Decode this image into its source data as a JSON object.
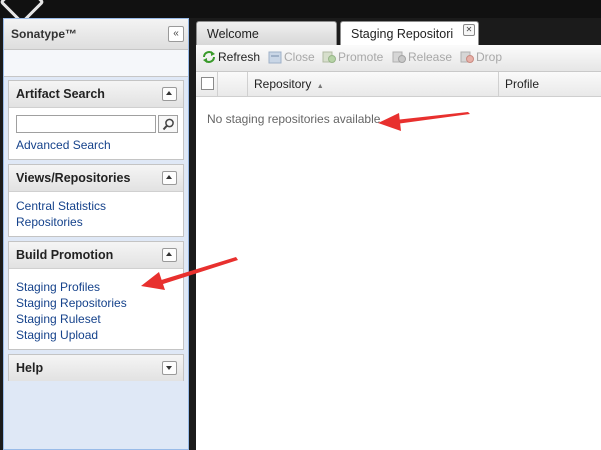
{
  "sidebar": {
    "brand": "Sonatype™",
    "collapse_icon": "«",
    "panels": {
      "artifact_search": {
        "title": "Artifact Search",
        "search_value": "",
        "advanced_link": "Advanced Search"
      },
      "views": {
        "title": "Views/Repositories",
        "links": [
          "Central Statistics",
          "Repositories"
        ]
      },
      "build_promotion": {
        "title": "Build Promotion",
        "links": [
          "Staging Profiles",
          "Staging Repositories",
          "Staging Ruleset",
          "Staging Upload"
        ]
      },
      "help": {
        "title": "Help"
      }
    }
  },
  "tabs": [
    {
      "label": "Welcome"
    },
    {
      "label": "Staging Repositori",
      "close": "✕"
    }
  ],
  "toolbar": {
    "refresh": "Refresh",
    "close": "Close",
    "promote": "Promote",
    "release": "Release",
    "drop": "Drop"
  },
  "grid": {
    "columns": [
      "Repository",
      "Profile"
    ],
    "sort_indicator": "▲",
    "empty_text": "No staging repositories available"
  },
  "colors": {
    "annotation_arrow": "#e8302e",
    "link": "#15428b",
    "refresh_icon": "#3a9a2b"
  }
}
